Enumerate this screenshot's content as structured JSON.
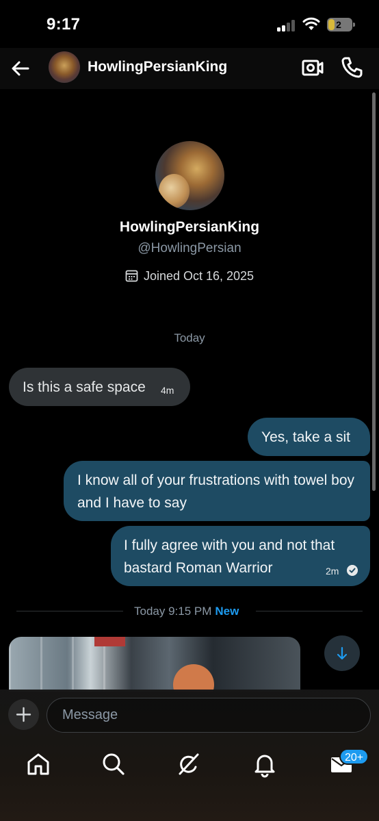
{
  "status_bar": {
    "time": "9:17",
    "battery_level": "2"
  },
  "header": {
    "back_label": "back",
    "name": "HowlingPersianKing"
  },
  "profile": {
    "name": "HowlingPersianKing",
    "handle": "@HowlingPersian",
    "joined": "Joined Oct 16, 2025"
  },
  "conversation": {
    "day_label": "Today",
    "messages": [
      {
        "direction": "incoming",
        "text": "Is this a safe space",
        "time": "4m"
      },
      {
        "direction": "outgoing",
        "text": "Yes, take a sit"
      },
      {
        "direction": "outgoing",
        "text": "I know all of your frustrations with towel boy and I have to say"
      },
      {
        "direction": "outgoing",
        "text": "I fully agree with you and not that bastard Roman Warrior",
        "time": "2m",
        "status": "read"
      }
    ],
    "divider": {
      "label": "Today 9:15 PM",
      "new_label": "New"
    }
  },
  "composer": {
    "placeholder": "Message"
  },
  "tab_bar": {
    "items": [
      "home-icon",
      "search-icon",
      "grok-icon",
      "notifications-icon",
      "messages-icon"
    ],
    "messages_badge": "20+"
  },
  "colors": {
    "accent": "#1d9bf0",
    "outgoing_bubble": "#1e4b63",
    "incoming_bubble": "#2f3336",
    "background": "#000000"
  }
}
